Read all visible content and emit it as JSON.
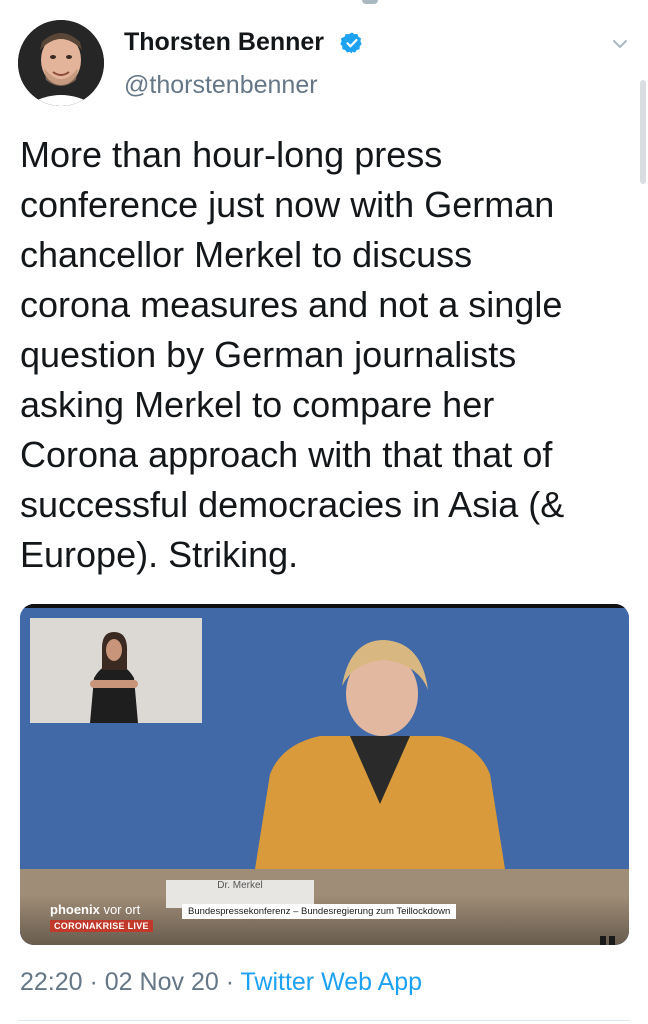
{
  "author": {
    "name": "Thorsten Benner",
    "handle": "@thorstenbenner"
  },
  "tweet": {
    "text": "More than hour-long press\nconference just now with German\nchancellor Merkel to discuss\ncorona measures and not a single\nquestion by German journalists\nasking Merkel to compare her\nCorona approach with that that of\nsuccessful democracies in Asia (&\nEurope). Striking."
  },
  "media": {
    "broadcaster_brand_main": "phoenix",
    "broadcaster_brand_sub": " vor ort",
    "live_badge": "CORONAKRISE LIVE",
    "name_plate": "Dr. Merkel",
    "caption": "Bundespressekonferenz – Bundesregierung zum Teillockdown"
  },
  "meta": {
    "time": "22:20",
    "sep1": " · ",
    "date": "02 Nov 20",
    "sep2": " · ",
    "app": "Twitter Web App"
  },
  "colors": {
    "verified": "#1da1f2",
    "link": "#1da1f2",
    "secondary_text": "#657786"
  },
  "icons": {
    "verified": "verified-badge-icon",
    "caret": "chevron-down-icon"
  }
}
